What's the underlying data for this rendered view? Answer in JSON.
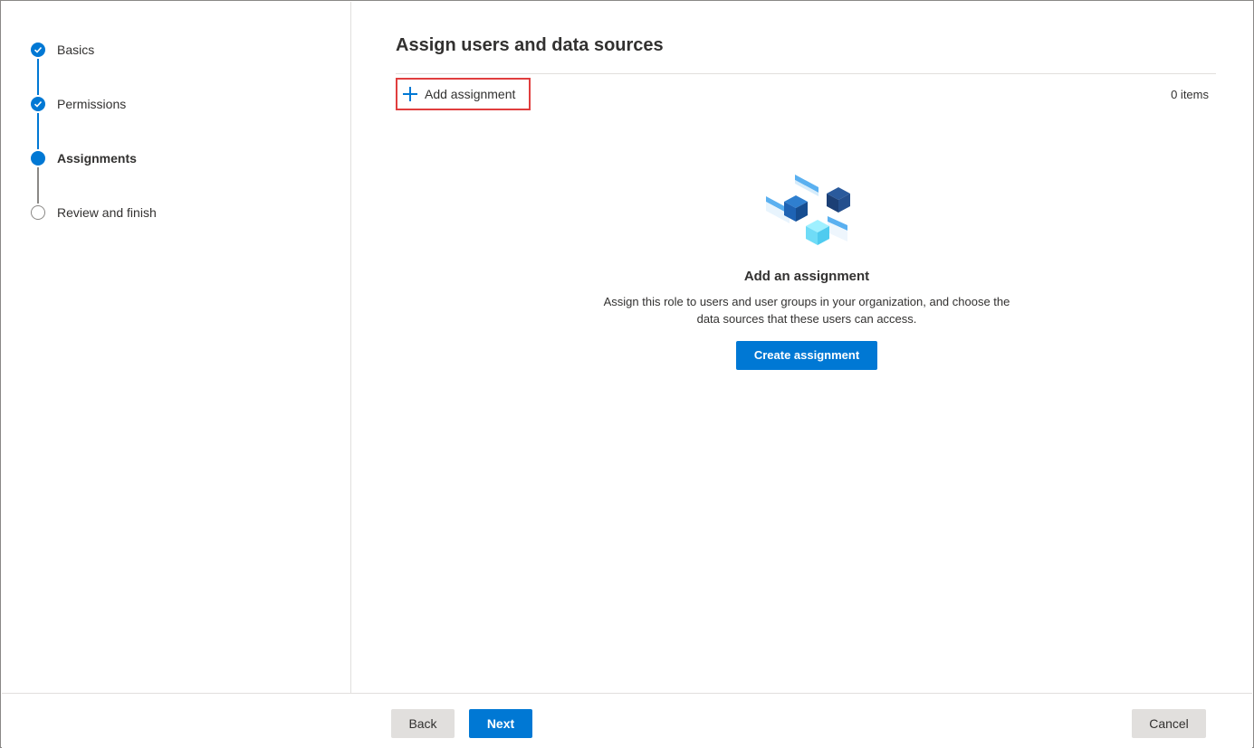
{
  "wizard": {
    "steps": [
      {
        "label": "Basics",
        "state": "completed"
      },
      {
        "label": "Permissions",
        "state": "completed"
      },
      {
        "label": "Assignments",
        "state": "current"
      },
      {
        "label": "Review and finish",
        "state": "pending"
      }
    ]
  },
  "main": {
    "title": "Assign users and data sources",
    "add_label": "Add assignment",
    "item_count": "0 items",
    "empty_state": {
      "icon": "cubes-illustration",
      "title": "Add an assignment",
      "description_line1": "Assign this role to users and user groups in your organization, and choose the",
      "description_line2": "data sources that these users can access.",
      "button": "Create assignment"
    }
  },
  "footer": {
    "back": "Back",
    "next": "Next",
    "cancel": "Cancel"
  },
  "colors": {
    "accent": "#0078d4",
    "highlight_border": "#e03e3e"
  }
}
